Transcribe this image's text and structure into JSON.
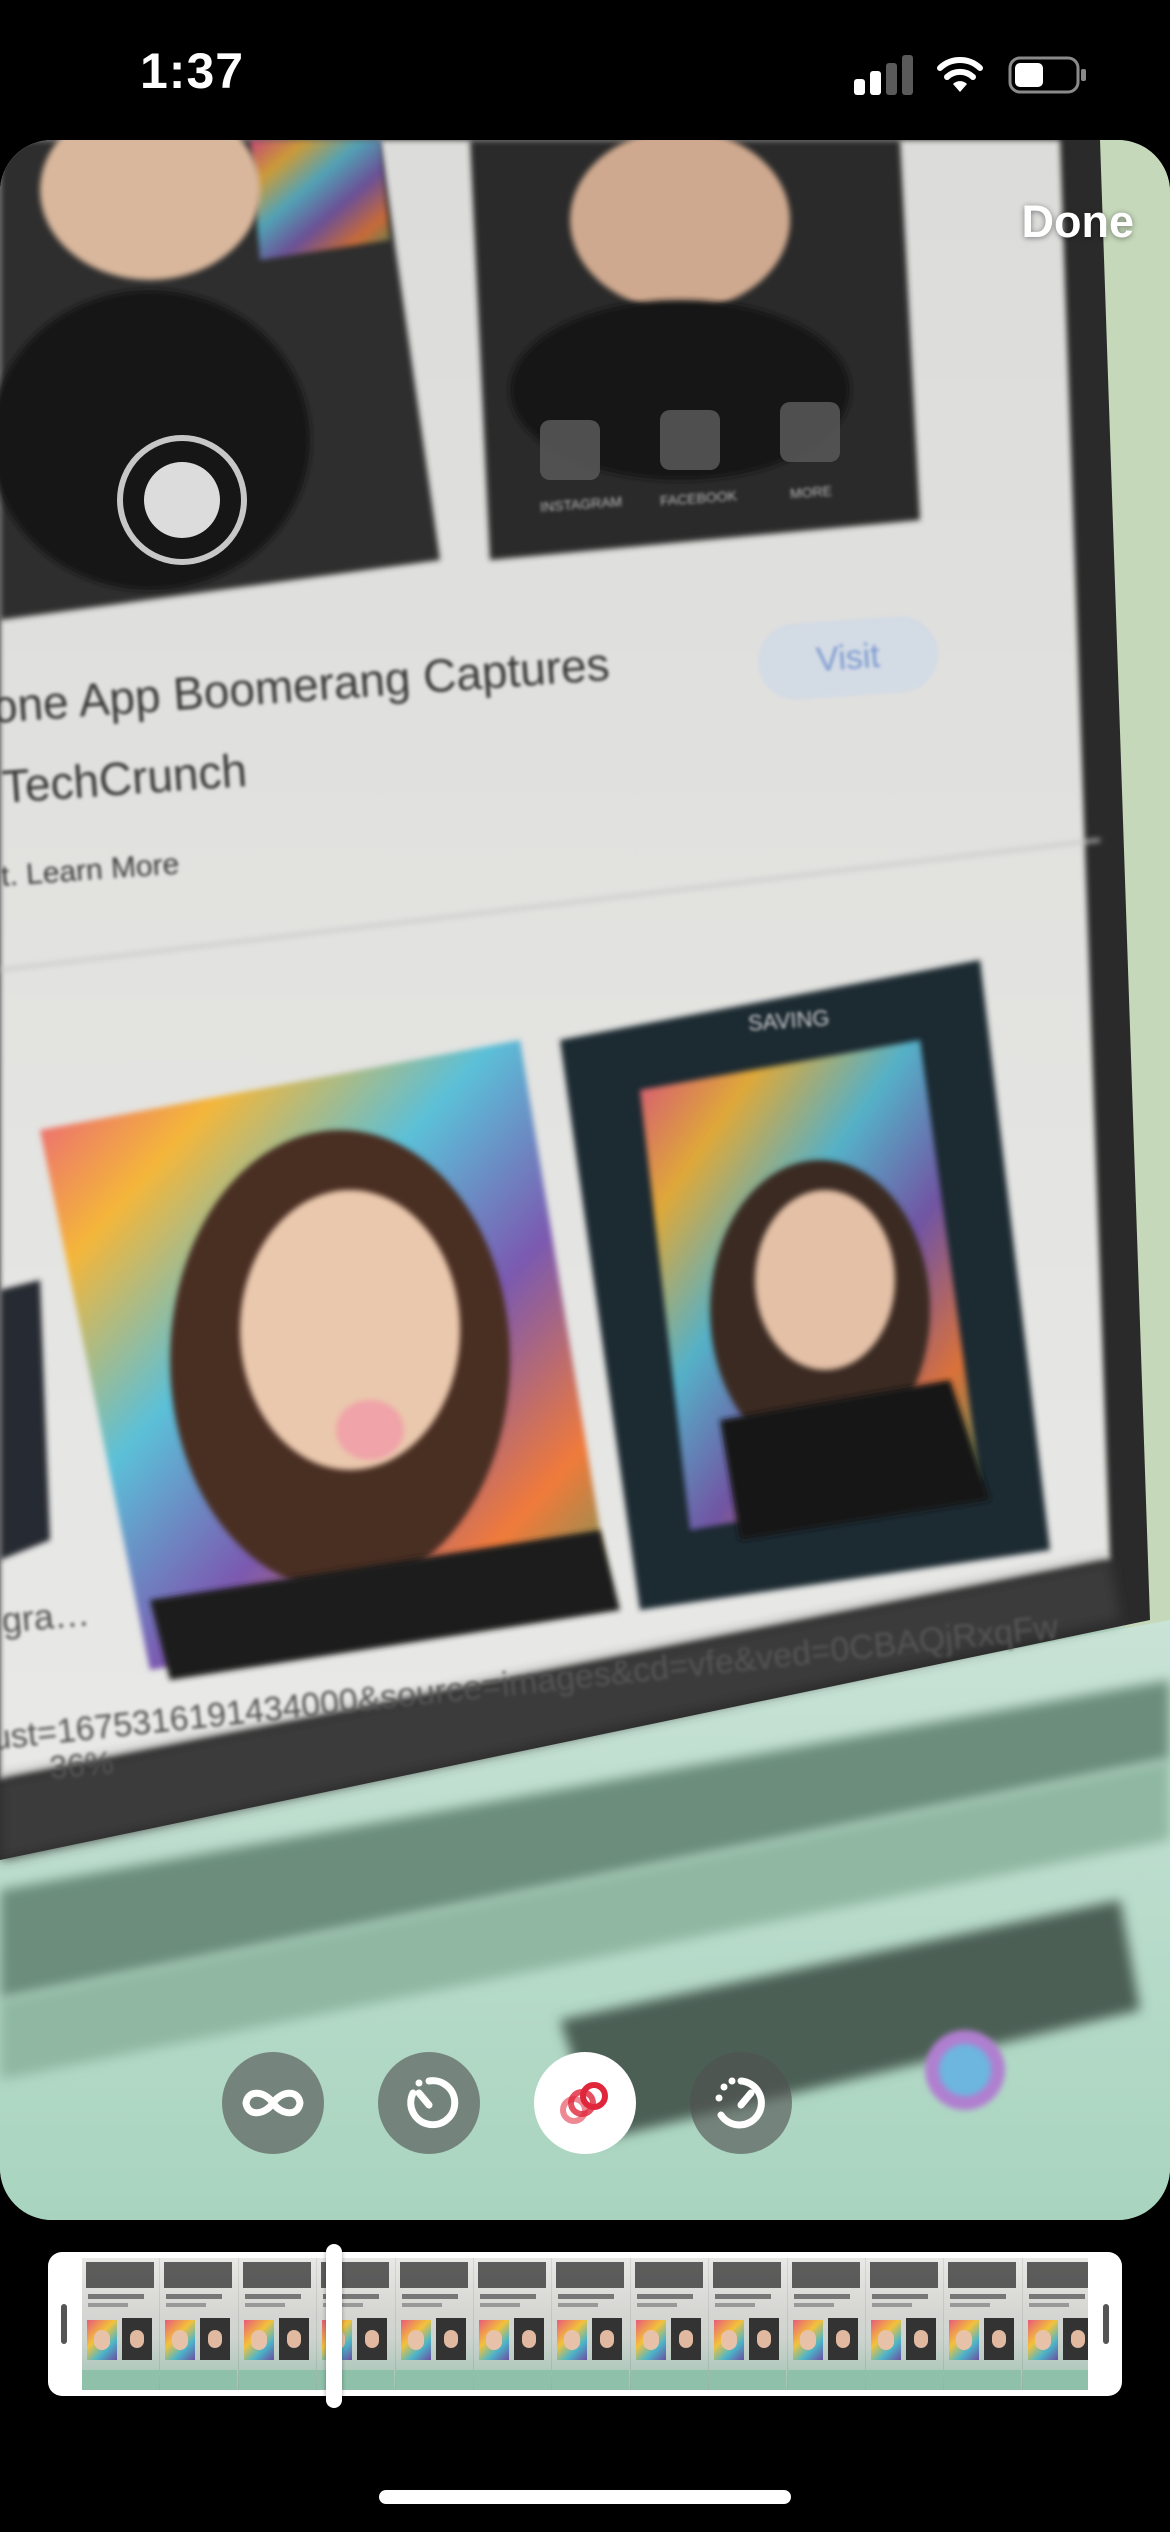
{
  "status_bar": {
    "time": "1:37",
    "signal_bars_active": 2,
    "signal_bars_total": 4,
    "battery_level": 0.4
  },
  "header": {
    "done_label": "Done"
  },
  "photo_text": {
    "heading_line1": "one App Boomerang Captures",
    "heading_line2": "TechCrunch",
    "learn_more": "t. Learn More",
    "visit": "Visit",
    "saving": "SAVING",
    "instagram": "INSTAGRAM",
    "facebook": "FACEBOOK",
    "more": "MORE",
    "url_fragment": "ust=1675316191434000&source=images&cd=vfe&ved=0CBAQjRxqFw",
    "percent": "36%",
    "grab": "gra…"
  },
  "modes": [
    {
      "name": "loop",
      "icon": "infinity-icon",
      "selected": false
    },
    {
      "name": "slowmo",
      "icon": "slow-motion-icon",
      "selected": false
    },
    {
      "name": "echo",
      "icon": "echo-icon",
      "selected": true
    },
    {
      "name": "duo",
      "icon": "duo-speed-icon",
      "selected": false
    }
  ],
  "trimmer": {
    "frame_count": 13,
    "playhead_position": 0.25
  },
  "colors": {
    "accent_red": "#e0263b",
    "selected_bg": "#ffffff",
    "button_bg": "#505050"
  }
}
